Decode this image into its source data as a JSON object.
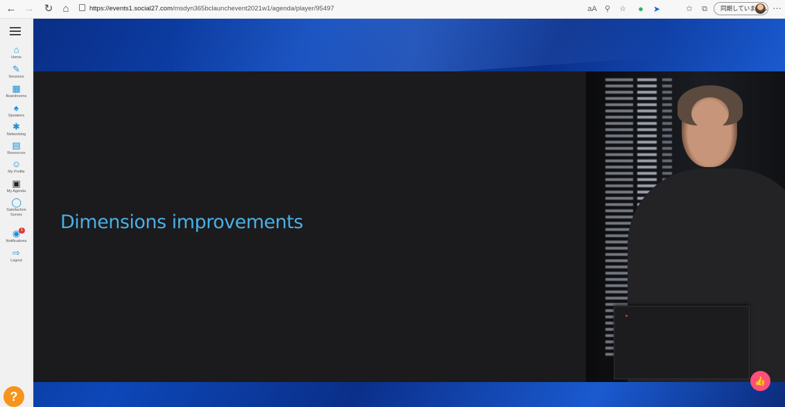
{
  "browser": {
    "url_host": "https://events1.social27.com",
    "url_path": "/msdyn365bclaunchevent2021w1/agenda/player/95497",
    "profile_label": "同期していません",
    "icons": [
      "back-icon",
      "forward-icon",
      "refresh-icon",
      "home-icon",
      "lock-icon",
      "read-aloud-icon",
      "zoom-icon",
      "favorite-add-icon",
      "extension-green-icon",
      "extension-blue-icon",
      "favorites-icon",
      "collections-icon",
      "more-icon"
    ]
  },
  "sidebar": {
    "items": [
      {
        "label": "Home",
        "icon": "home-icon"
      },
      {
        "label": "Sessions",
        "icon": "pencil-icon"
      },
      {
        "label": "Boardrooms",
        "icon": "boardroom-icon"
      },
      {
        "label": "Speakers",
        "icon": "speaker-icon"
      },
      {
        "label": "Networking",
        "icon": "network-icon"
      },
      {
        "label": "Resources",
        "icon": "resources-icon"
      },
      {
        "label": "My Profile",
        "icon": "profile-icon"
      },
      {
        "label": "My Agenda",
        "icon": "calendar-icon"
      },
      {
        "label": "Satisfaction Survey",
        "icon": "survey-icon"
      },
      {
        "label": "Notifications",
        "icon": "bell-icon",
        "badge": "1"
      },
      {
        "label": "Logout",
        "icon": "logout-icon"
      }
    ],
    "help_label": "?"
  },
  "player": {
    "slide_title": "Dimensions improvements"
  },
  "colors": {
    "accent": "#1a8fd6",
    "slide_title": "#4ab0e6",
    "help": "#f7941d",
    "like": "#ff4f79"
  }
}
